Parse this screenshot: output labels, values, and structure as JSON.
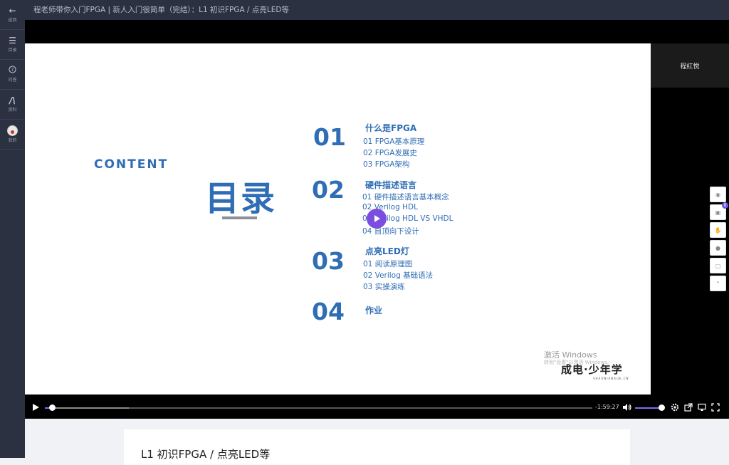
{
  "window": {
    "title": "程老师带你入门FPGA | 新人入门很简单（完结）：L1 初识FPGA / 点亮LED等"
  },
  "sidebar": {
    "items": [
      {
        "icon": "back-arrow-icon",
        "label": "返回"
      },
      {
        "icon": "list-icon",
        "label": "目录"
      },
      {
        "icon": "question-icon",
        "label": "问答"
      },
      {
        "icon": "document-icon",
        "label": "资料"
      },
      {
        "icon": "avatar-icon",
        "label": "我的"
      }
    ]
  },
  "slide": {
    "content_word": "CONTENT",
    "mulu": "目录",
    "sections": [
      {
        "num": "01",
        "title": "什么是FPGA",
        "items": [
          "01 FPGA基本原理",
          "02 FPGA发展史",
          "03 FPGA架构"
        ]
      },
      {
        "num": "02",
        "title": "硬件描述语言",
        "items": [
          "01 硬件描述语言基本概念",
          "02 Verilog HDL",
          "03 Verilog HDL VS  VHDL",
          "04 自顶向下设计"
        ]
      },
      {
        "num": "03",
        "title": "点亮LED灯",
        "items": [
          "01 阅读原理图",
          "02 Verilog 基础语法",
          "03 实操演练"
        ]
      },
      {
        "num": "04",
        "title": "作业",
        "items": []
      }
    ],
    "watermark_line1": "激活 Windows",
    "watermark_line2": "转到\"设置\"以激活 Windows。",
    "logo": "成电·少年学",
    "logo_sub": "SHAONIANXUE.CN"
  },
  "teacher": {
    "name": "程红悦"
  },
  "player": {
    "time_remaining": "-1:59:27",
    "progress_fraction": 0.013,
    "buffered_fraction": 0.153,
    "volume_fraction": 1.0
  },
  "float_toolbar": {
    "items": [
      "palette-icon",
      "cart-icon",
      "hand-icon",
      "wechat-icon",
      "comment-icon",
      "scroll-top-icon"
    ],
    "cart_badge": "0"
  },
  "lesson": {
    "title": "L1 初识FPGA / 点亮LED等"
  }
}
